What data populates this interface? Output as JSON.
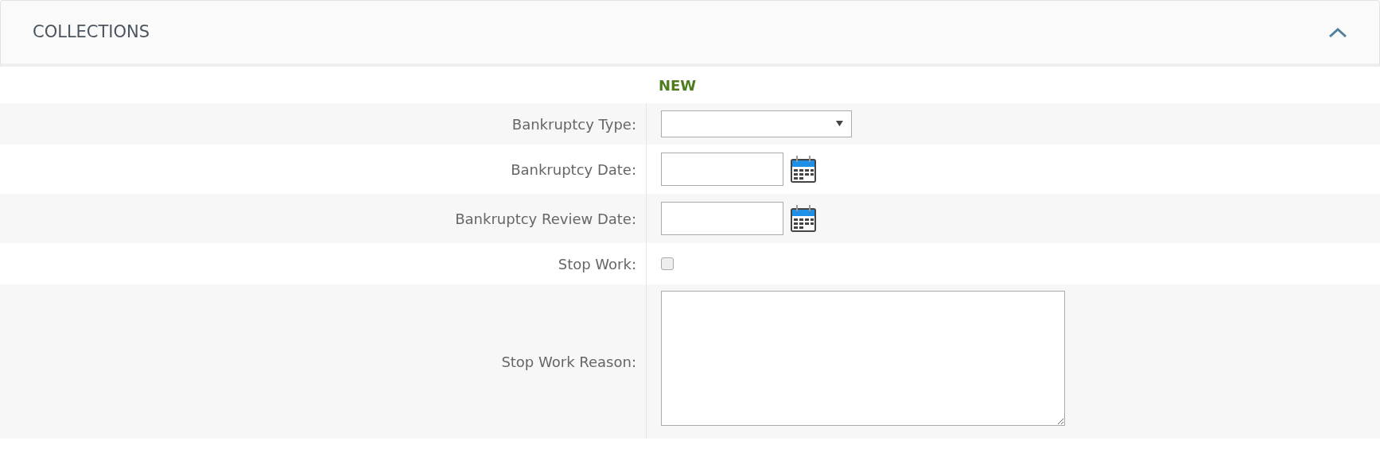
{
  "panel": {
    "title": "COLLECTIONS",
    "expanded": true
  },
  "status": "NEW",
  "fields": [
    {
      "kind": "select",
      "label": "Bankruptcy Type:"
    },
    {
      "kind": "date",
      "label": "Bankruptcy Date:"
    },
    {
      "kind": "date",
      "label": "Bankruptcy Review Date:"
    },
    {
      "kind": "checkbox",
      "label": "Stop Work:",
      "checked": false
    },
    {
      "kind": "textarea",
      "label": "Stop Work Reason:"
    }
  ]
}
